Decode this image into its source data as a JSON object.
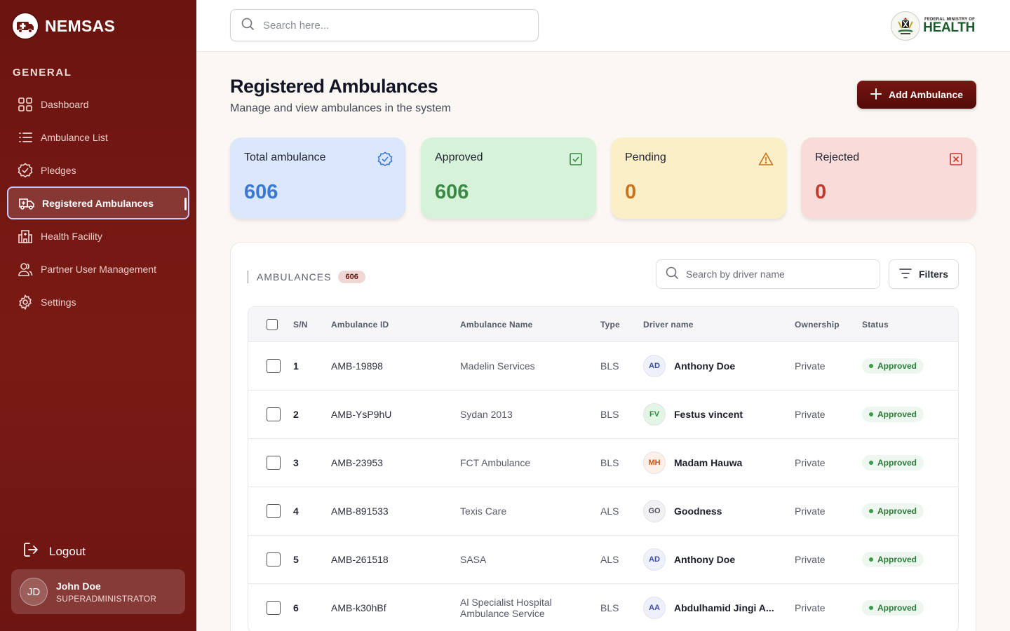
{
  "brand": {
    "name": "NEMSAS"
  },
  "sidebar": {
    "section_label": "GENERAL",
    "items": [
      {
        "label": "Dashboard",
        "icon": "grid-icon"
      },
      {
        "label": "Ambulance List",
        "icon": "list-icon"
      },
      {
        "label": "Pledges",
        "icon": "badge-check-icon"
      },
      {
        "label": "Registered Ambulances",
        "icon": "ambulance-icon",
        "active": true
      },
      {
        "label": "Health Facility",
        "icon": "hospital-icon"
      },
      {
        "label": "Partner User Management",
        "icon": "users-icon"
      },
      {
        "label": "Settings",
        "icon": "gear-icon"
      }
    ],
    "logout_label": "Logout",
    "user": {
      "initials": "JD",
      "name": "John Doe",
      "role": "SUPERADMINISTRATOR"
    }
  },
  "topbar": {
    "search_placeholder": "Search here...",
    "ministry_small": "FEDERAL MINISTRY OF",
    "ministry_big": "HEALTH"
  },
  "page": {
    "title": "Registered Ambulances",
    "subtitle": "Manage and view ambulances in the system",
    "add_button": "Add Ambulance"
  },
  "stats": [
    {
      "label": "Total ambulance",
      "value": "606",
      "color": "#3a78d6",
      "bg": "#dbe8fb",
      "icon": "verified-badge-icon"
    },
    {
      "label": "Approved",
      "value": "606",
      "color": "#3a8a47",
      "bg": "#d6f2d8",
      "icon": "check-square-icon"
    },
    {
      "label": "Pending",
      "value": "0",
      "color": "#c9731a",
      "bg": "#fbefc7",
      "icon": "warning-icon"
    },
    {
      "label": "Rejected",
      "value": "0",
      "color": "#c0392b",
      "bg": "#f9dcd9",
      "icon": "x-square-icon"
    }
  ],
  "table": {
    "title": "AMBULANCES",
    "count": "606",
    "driver_search_placeholder": "Search by driver name",
    "filters_label": "Filters",
    "columns": [
      "S/N",
      "Ambulance ID",
      "Ambulance Name",
      "Type",
      "Driver name",
      "Ownership",
      "Status"
    ],
    "rows": [
      {
        "sn": "1",
        "id": "AMB-19898",
        "name": "Madelin Services",
        "type": "BLS",
        "initials": "AD",
        "driver": "Anthony Doe",
        "ownership": "Private",
        "status": "Approved",
        "av_color": "#3b4aa8",
        "av_bg": "#eef0fb"
      },
      {
        "sn": "2",
        "id": "AMB-YsP9hU",
        "name": "Sydan 2013",
        "type": "BLS",
        "initials": "FV",
        "driver": "Festus vincent",
        "ownership": "Private",
        "status": "Approved",
        "av_color": "#2d8a3e",
        "av_bg": "#e3f6e6"
      },
      {
        "sn": "3",
        "id": "AMB-23953",
        "name": "FCT Ambulance",
        "type": "BLS",
        "initials": "MH",
        "driver": "Madam Hauwa",
        "ownership": "Private",
        "status": "Approved",
        "av_color": "#c0582a",
        "av_bg": "#fdf0e8"
      },
      {
        "sn": "4",
        "id": "AMB-891533",
        "name": "Texis Care",
        "type": "ALS",
        "initials": "GO",
        "driver": "Goodness",
        "ownership": "Private",
        "status": "Approved",
        "av_color": "#50535e",
        "av_bg": "#f1f1f4"
      },
      {
        "sn": "5",
        "id": "AMB-261518",
        "name": "SASA",
        "type": "ALS",
        "initials": "AD",
        "driver": "Anthony Doe",
        "ownership": "Private",
        "status": "Approved",
        "av_color": "#3b4aa8",
        "av_bg": "#eef0fb"
      },
      {
        "sn": "6",
        "id": "AMB-k30hBf",
        "name": "Al Specialist Hospital Ambulance Service",
        "type": "BLS",
        "initials": "AA",
        "driver": "Abdulhamid Jingi A...",
        "ownership": "Private",
        "status": "Approved",
        "av_color": "#3b4aa8",
        "av_bg": "#eef0fb"
      }
    ]
  }
}
